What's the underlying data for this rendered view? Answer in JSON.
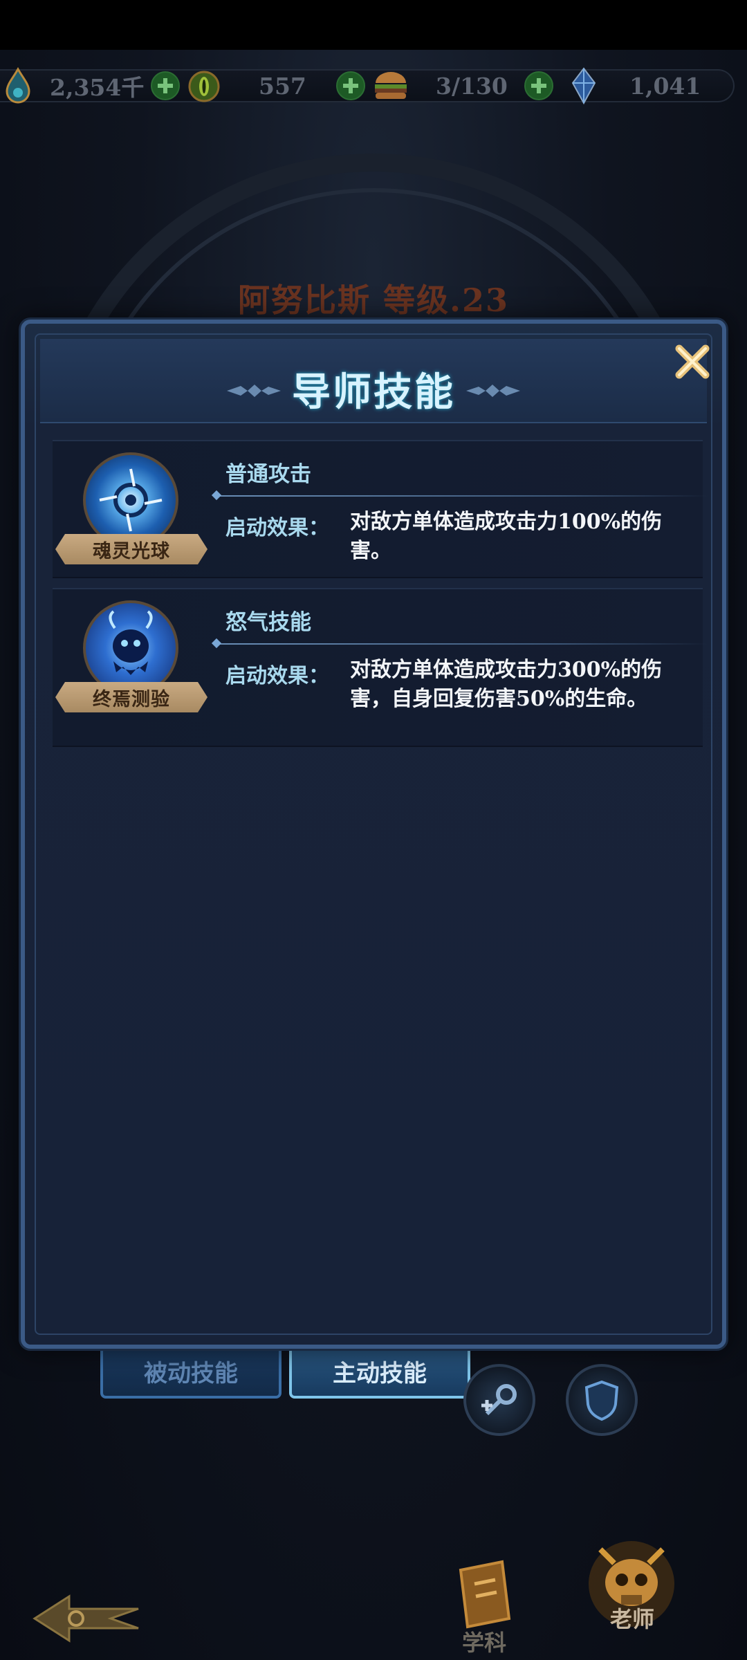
{
  "resources": [
    {
      "icon": "soul-drop-icon",
      "value": "2,354千"
    },
    {
      "icon": "eye-gem-icon",
      "value": "557"
    },
    {
      "icon": "burger-icon",
      "value": "3/130"
    },
    {
      "icon": "blue-crystal-icon",
      "value": "1,041"
    }
  ],
  "hero": {
    "title": "阿努比斯 等级.23"
  },
  "tabs": {
    "passive": "被动技能",
    "active": "主动技能"
  },
  "bottom_nav": {
    "subject": "学科",
    "teacher": "老师"
  },
  "modal": {
    "title": "导师技能",
    "skills": [
      {
        "icon": "soul-orb-icon",
        "tag": "魂灵光球",
        "name": "普通攻击",
        "effect_label": "启动效果：",
        "effect_text": "对敌方单体造成攻击力100%的伤害。"
      },
      {
        "icon": "ghost-spirit-icon",
        "tag": "终焉测验",
        "name": "怒气技能",
        "effect_label": "启动效果：",
        "effect_text": "对敌方单体造成攻击力300%的伤害，自身回复伤害50%的生命。"
      }
    ]
  },
  "colors": {
    "accent_cyan": "#a9d9ee",
    "tag_gold": "#c9aa82",
    "modal_bg": "#172238"
  }
}
